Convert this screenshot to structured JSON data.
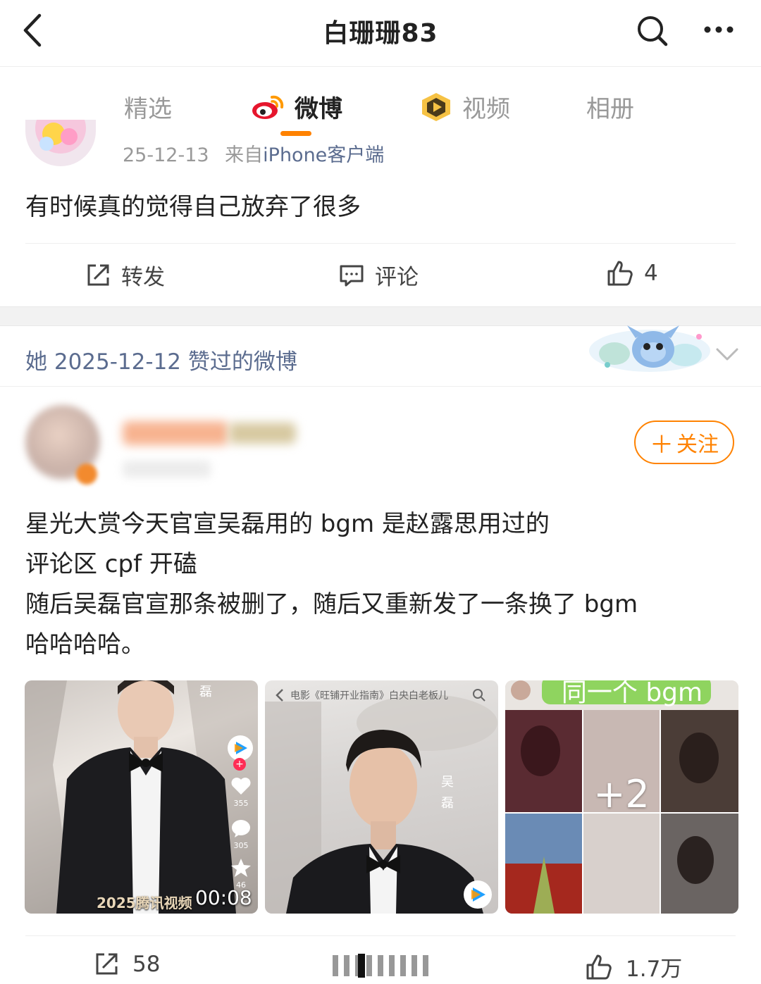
{
  "header": {
    "title": "白珊珊83",
    "back_icon": "chevron-left-icon",
    "search_icon": "search-icon",
    "more_icon": "more-dots-icon"
  },
  "tabs": [
    {
      "label": "精选",
      "active": false
    },
    {
      "label": "微博",
      "active": true,
      "icon": "weibo-logo-icon"
    },
    {
      "label": "视频",
      "active": false,
      "icon": "video-badge-icon"
    },
    {
      "label": "相册",
      "active": false
    }
  ],
  "accent_color": "#ff8200",
  "post1": {
    "date": "25-12-13",
    "source_prefix": "来自",
    "source": "iPhone客户端",
    "text": "有时候真的觉得自己放弃了很多",
    "actions": {
      "repost_label": "转发",
      "comment_label": "评论",
      "like_count": "4"
    }
  },
  "liked_section": {
    "header": "她 2025-12-12 赞过的微博"
  },
  "post2": {
    "follow_label": "关注",
    "text_lines": [
      "星光大赏今天官宣吴磊用的 bgm 是赵露思用过的",
      "评论区 cpf 开磕",
      "随后吴磊官宣那条被删了，随后又重新发了一条换了 bgm",
      "哈哈哈哈。"
    ],
    "images": {
      "img1": {
        "watermark": "2025腾讯视频",
        "duration": "00:08",
        "side_char": "磊",
        "like_count": "355",
        "comment_count": "305",
        "fav_count": "46"
      },
      "img2": {
        "top_text": "电影《旺铺开业指南》白央白老板儿",
        "side_char_1": "吴",
        "side_char_2": "磊"
      },
      "img3": {
        "top_text": "同一个 bgm",
        "more_count": "+2"
      }
    },
    "actions": {
      "repost_count": "58",
      "like_count": "1.7万"
    }
  }
}
